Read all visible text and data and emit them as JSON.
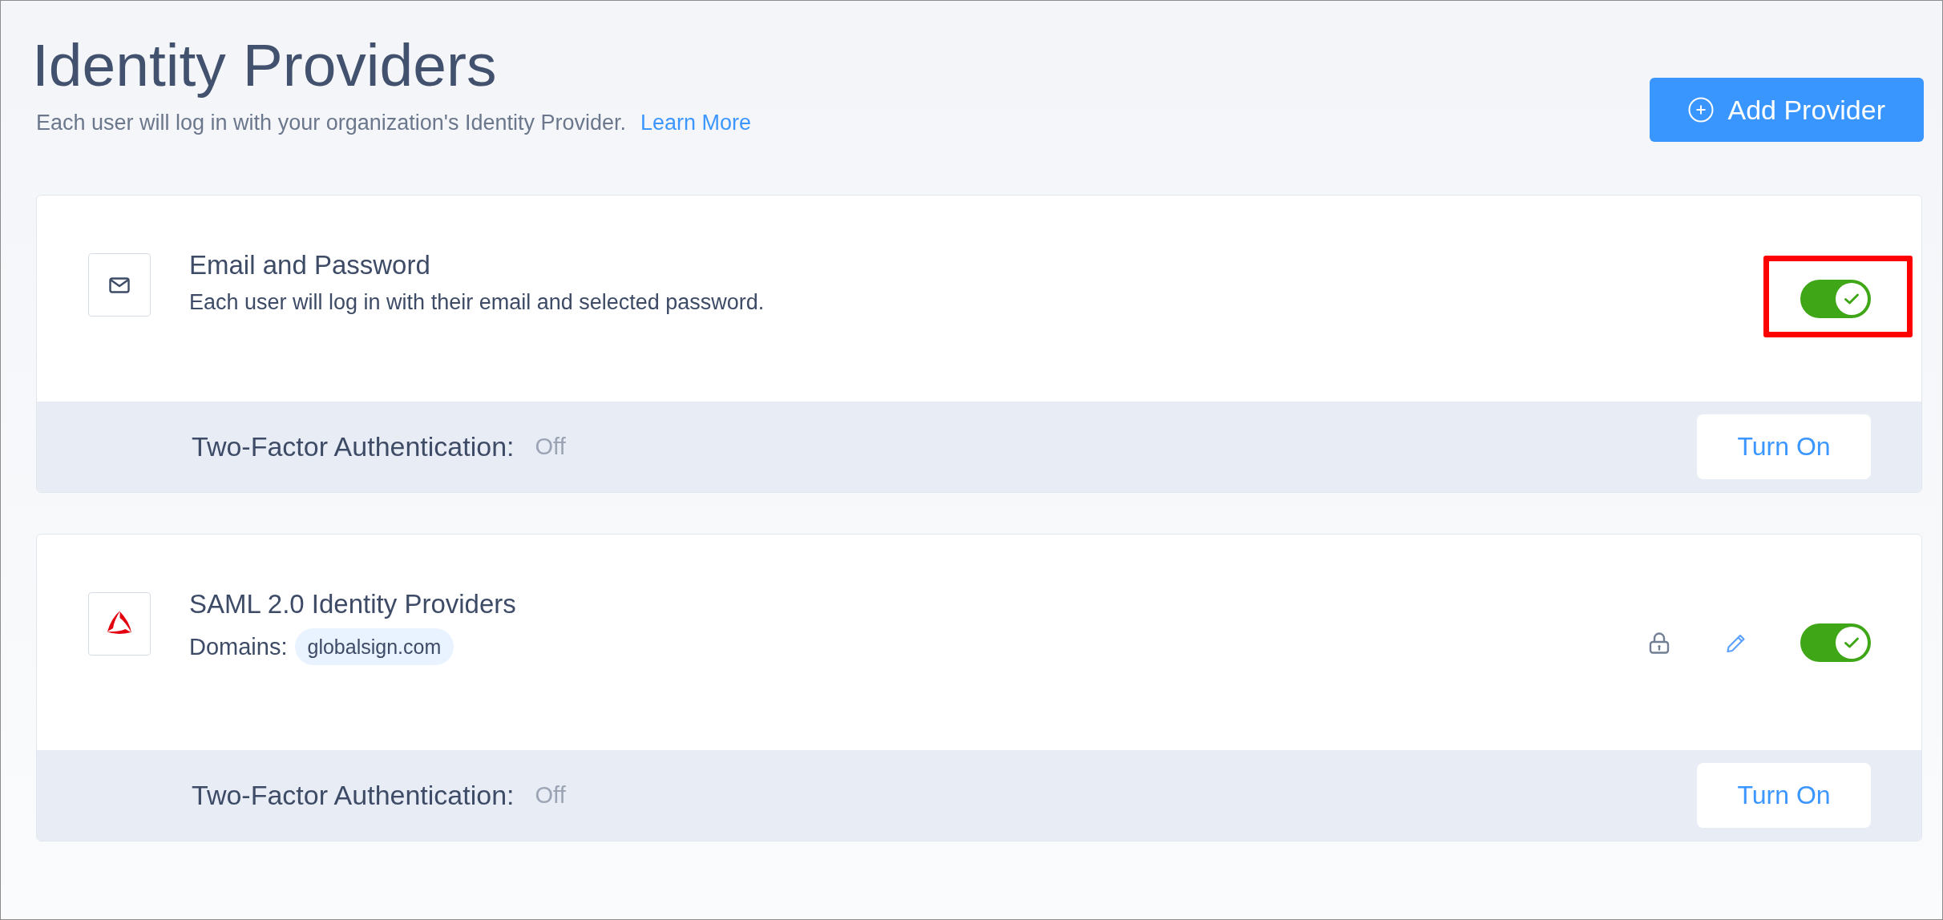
{
  "header": {
    "title": "Identity Providers",
    "subtitle": "Each user will log in with your organization's Identity Provider.",
    "link": "Learn More",
    "add_button": "Add Provider"
  },
  "providers": [
    {
      "kind": "email",
      "name": "Email and Password",
      "description": "Each user will log in with their email and selected password.",
      "enabled": true,
      "highlighted": true,
      "two_factor": {
        "label": "Two-Factor Authentication:",
        "status": "Off",
        "button": "Turn On"
      }
    },
    {
      "kind": "saml",
      "name": "SAML 2.0 Identity Providers",
      "domains_label": "Domains:",
      "domains": [
        "globalsign.com"
      ],
      "enabled": true,
      "highlighted": false,
      "two_factor": {
        "label": "Two-Factor Authentication:",
        "status": "Off",
        "button": "Turn On"
      }
    }
  ]
}
